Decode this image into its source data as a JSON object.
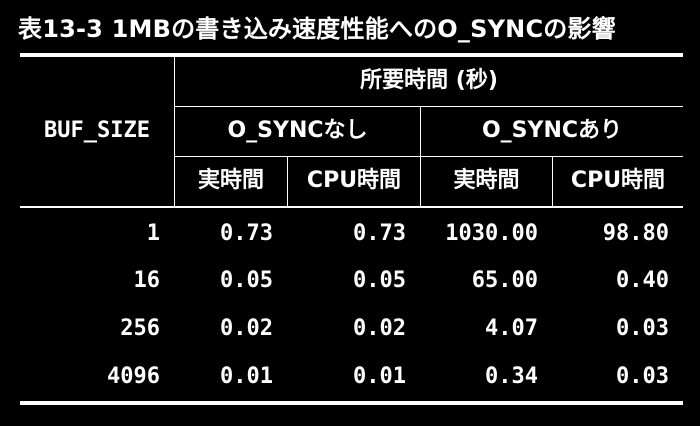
{
  "caption": "表13-3 1MBの書き込み速度性能へのO_SYNCの影響",
  "header": {
    "row_label": "BUF_SIZE",
    "group_title": "所要時間 (秒)",
    "subgroups": [
      "O_SYNCなし",
      "O_SYNCあり"
    ],
    "columns": [
      "実時間",
      "CPU時間",
      "実時間",
      "CPU時間"
    ]
  },
  "rows": [
    {
      "buf_size": "1",
      "values": [
        "0.73",
        "0.73",
        "1030.00",
        "98.80"
      ]
    },
    {
      "buf_size": "16",
      "values": [
        "0.05",
        "0.05",
        "65.00",
        "0.40"
      ]
    },
    {
      "buf_size": "256",
      "values": [
        "0.02",
        "0.02",
        "4.07",
        "0.03"
      ]
    },
    {
      "buf_size": "4096",
      "values": [
        "0.01",
        "0.01",
        "0.34",
        "0.03"
      ]
    }
  ]
}
